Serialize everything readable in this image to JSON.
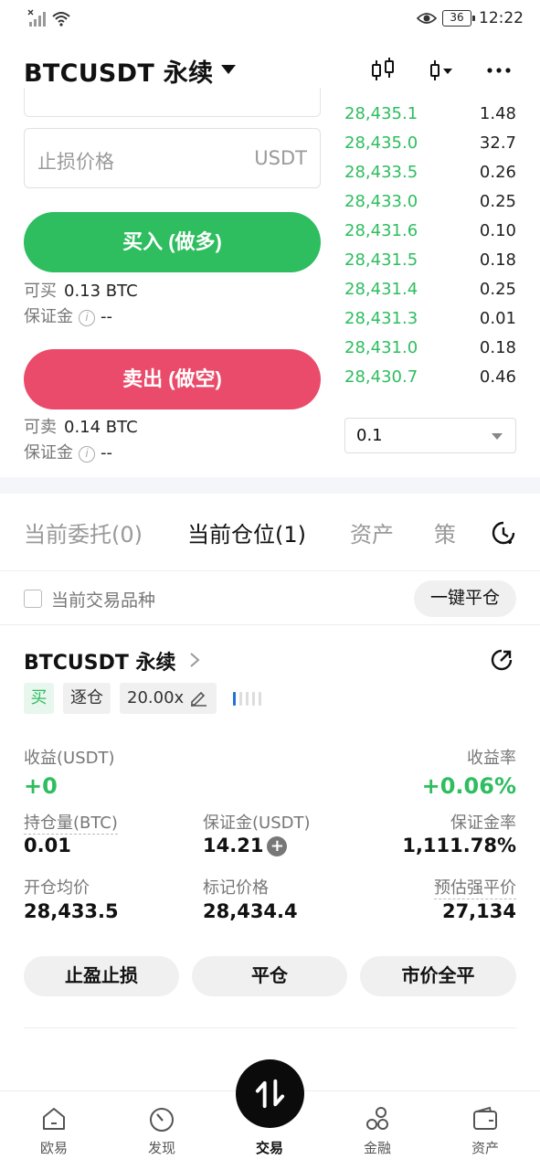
{
  "status_bar": {
    "time": "12:22",
    "battery": "36"
  },
  "header": {
    "title": "BTCUSDT 永续"
  },
  "order_form": {
    "stop_loss_placeholder": "止损价格",
    "stop_loss_unit": "USDT",
    "buy_button": "买入 (做多)",
    "sell_button": "卖出 (做空)",
    "buy_avail_label": "可买",
    "buy_avail_value": "0.13 BTC",
    "sell_avail_label": "可卖",
    "sell_avail_value": "0.14 BTC",
    "margin_label": "保证金",
    "margin_value": "--",
    "info_glyph": "i"
  },
  "orderbook": {
    "rows": [
      {
        "price": "28,435.1",
        "qty": "1.48"
      },
      {
        "price": "28,435.0",
        "qty": "32.7"
      },
      {
        "price": "28,433.5",
        "qty": "0.26"
      },
      {
        "price": "28,433.0",
        "qty": "0.25"
      },
      {
        "price": "28,431.6",
        "qty": "0.10"
      },
      {
        "price": "28,431.5",
        "qty": "0.18"
      },
      {
        "price": "28,431.4",
        "qty": "0.25"
      },
      {
        "price": "28,431.3",
        "qty": "0.01"
      },
      {
        "price": "28,431.0",
        "qty": "0.18"
      },
      {
        "price": "28,430.7",
        "qty": "0.46"
      }
    ],
    "depth_value": "0.1",
    "bid_color": "#2ebd5f"
  },
  "tabs": [
    {
      "label": "当前委托(0)"
    },
    {
      "label": "当前仓位(1)"
    },
    {
      "label": "资产"
    },
    {
      "label": "策"
    }
  ],
  "filter": {
    "checkbox_label": "当前交易品种",
    "close_all": "一键平仓"
  },
  "position": {
    "symbol": "BTCUSDT 永续",
    "side_tag": "买",
    "mode_tag": "逐仓",
    "leverage": "20.00x",
    "pnl_label": "收益(USDT)",
    "pnl_value": "+0",
    "roe_label": "收益率",
    "roe_value": "+0.06%",
    "size_label": "持仓量(BTC)",
    "size_value": "0.01",
    "margin_label": "保证金(USDT)",
    "margin_value": "14.21",
    "margin_add": "+",
    "margin_ratio_label": "保证金率",
    "margin_ratio_value": "1,111.78%",
    "entry_label": "开仓均价",
    "entry_value": "28,433.5",
    "mark_label": "标记价格",
    "mark_value": "28,434.4",
    "liq_label": "预估强平价",
    "liq_value": "27,134",
    "buttons": {
      "tpsl": "止盈止损",
      "close": "平仓",
      "market_close": "市价全平"
    }
  },
  "bottom_nav": [
    {
      "label": "欧易",
      "icon": "home-icon"
    },
    {
      "label": "发现",
      "icon": "discover-icon"
    },
    {
      "label": "交易",
      "icon": "trade-icon"
    },
    {
      "label": "金融",
      "icon": "finance-icon"
    },
    {
      "label": "资产",
      "icon": "wallet-icon"
    }
  ]
}
